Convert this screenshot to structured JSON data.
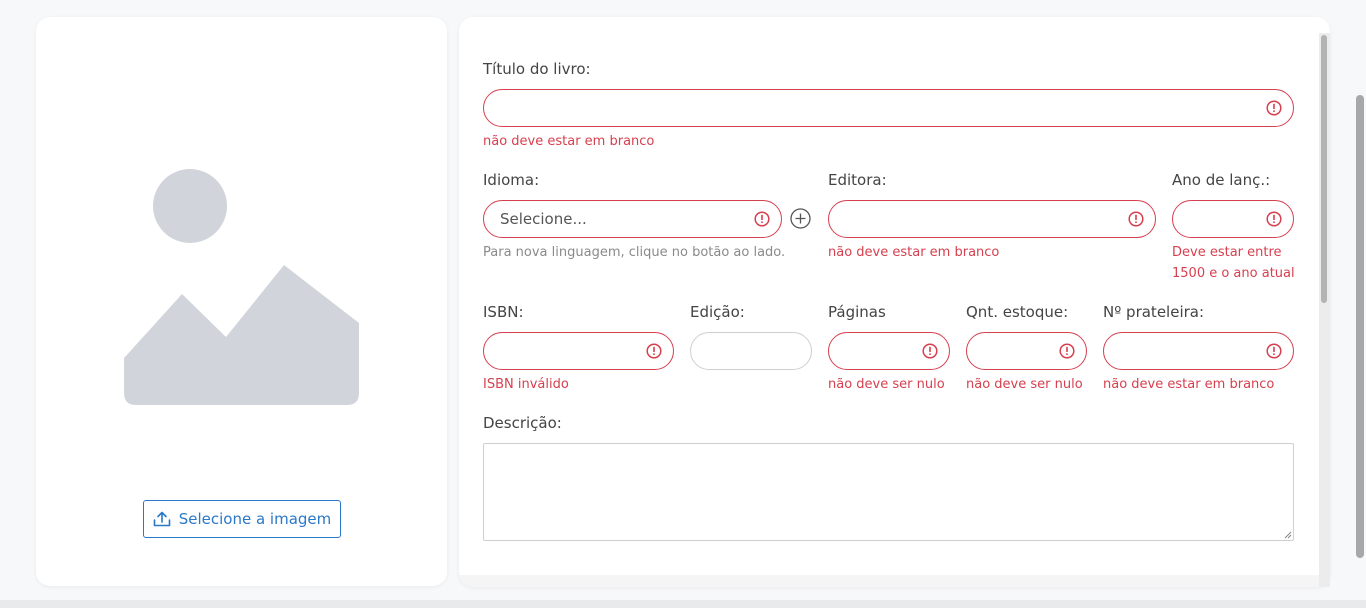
{
  "image_panel": {
    "upload_label": "Selecione a imagem"
  },
  "form": {
    "titulo": {
      "label": "Título do livro:",
      "error": "não deve estar em branco"
    },
    "idioma": {
      "label": "Idioma:",
      "placeholder": "Selecione...",
      "hint": "Para nova linguagem, clique no botão ao lado."
    },
    "editora": {
      "label": "Editora:",
      "error": "não deve estar em branco"
    },
    "ano": {
      "label": "Ano de lanç.:",
      "error_line1": "Deve estar entre",
      "error_line2": "1500 e o ano atual"
    },
    "isbn": {
      "label": "ISBN:",
      "error": "ISBN inválido"
    },
    "edicao": {
      "label": "Edição:"
    },
    "paginas": {
      "label": "Páginas",
      "error": "não deve ser nulo"
    },
    "estoque": {
      "label": "Qnt. estoque:",
      "error": "não deve ser nulo"
    },
    "prateleira": {
      "label": "Nº prateleira:",
      "error": "não deve estar em branco"
    },
    "descricao": {
      "label": "Descrição:"
    }
  },
  "colors": {
    "error": "#d6404f",
    "primary": "#2a78c8",
    "placeholder_graphic": "#d1d5db"
  },
  "icons": [
    "upload-icon",
    "error-icon",
    "add-circle-icon",
    "image-placeholder-icon",
    "resize-grip-icon"
  ]
}
